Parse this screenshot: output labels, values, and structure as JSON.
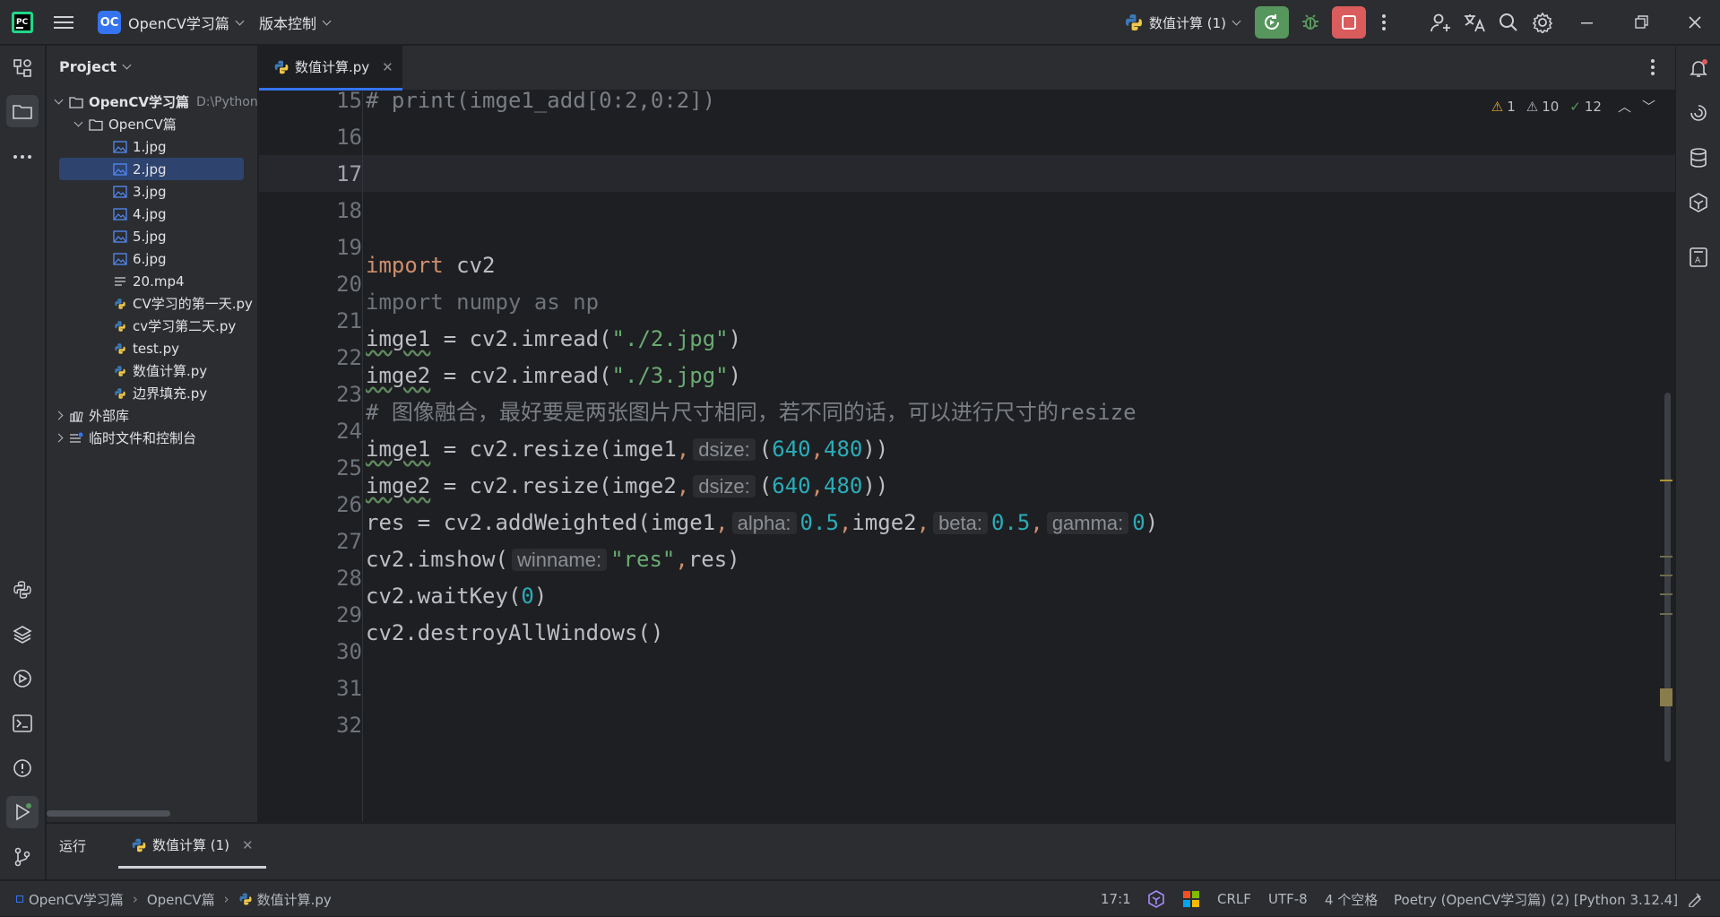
{
  "titlebar": {
    "project_badge": "OC",
    "project_name": "OpenCV学习篇",
    "vcs_label": "版本控制",
    "run_config": "数值计算 (1)"
  },
  "project_panel": {
    "title": "Project",
    "root": {
      "name": "OpenCV学习篇",
      "path": "D:\\Python"
    },
    "folder": "OpenCV篇",
    "files": [
      {
        "name": "1.jpg",
        "type": "image"
      },
      {
        "name": "2.jpg",
        "type": "image",
        "selected": true
      },
      {
        "name": "3.jpg",
        "type": "image"
      },
      {
        "name": "4.jpg",
        "type": "image"
      },
      {
        "name": "5.jpg",
        "type": "image"
      },
      {
        "name": "6.jpg",
        "type": "image"
      },
      {
        "name": "20.mp4",
        "type": "text"
      },
      {
        "name": "CV学习的第一天.py",
        "type": "python"
      },
      {
        "name": "cv学习第二天.py",
        "type": "python"
      },
      {
        "name": "test.py",
        "type": "python"
      },
      {
        "name": "数值计算.py",
        "type": "python"
      },
      {
        "name": "边界填充.py",
        "type": "python"
      }
    ],
    "external_libs": "外部库",
    "scratches": "临时文件和控制台"
  },
  "editor": {
    "tab_label": "数值计算.py",
    "inspections": {
      "warnings": "1",
      "weak_warnings": "10",
      "ok": "12"
    },
    "current_line": "17",
    "line_numbers": [
      "15",
      "16",
      "17",
      "18",
      "19",
      "20",
      "21",
      "22",
      "23",
      "24",
      "25",
      "26",
      "27",
      "28",
      "29",
      "30",
      "31",
      "32"
    ],
    "code": {
      "l15": "# print(imge1_add[0:2,0:2])",
      "l19_kw": "import",
      "l19_rest": " cv2",
      "l20": "import numpy as np",
      "l21_a": "imge1",
      "l21_b": " = cv2.imread(",
      "l21_str": "\"./2.jpg\"",
      "l21_c": ")",
      "l22_a": "imge2",
      "l22_b": " = cv2.imread(",
      "l22_str": "\"./3.jpg\"",
      "l22_c": ")",
      "l23": "# 图像融合，最好要是两张图片尺寸相同，若不同的话，可以进行尺寸的resize",
      "l24_a": "imge1",
      "l24_b": " = cv2.resize(imge1",
      "l24_hint": "dsize:",
      "l24_n1": "640",
      "l24_n2": "480",
      "l25_a": "imge2",
      "l25_b": " = cv2.resize(imge2",
      "l25_hint": "dsize:",
      "l25_n1": "640",
      "l25_n2": "480",
      "l26_a": "res = cv2.addWeighted(imge1",
      "l26_h1": "alpha:",
      "l26_n1": "0.5",
      "l26_b": "imge2",
      "l26_h2": "beta:",
      "l26_n2": "0.5",
      "l26_h3": "gamma:",
      "l26_n3": "0",
      "l27_a": "cv2.imshow(",
      "l27_hint": "winname:",
      "l27_str": "\"res\"",
      "l27_b": "res)",
      "l28_a": "cv2.waitKey(",
      "l28_n": "0",
      "l28_b": ")",
      "l29": "cv2.destroyAllWindows()"
    }
  },
  "bottom_panel": {
    "run_label": "运行",
    "run_tab": "数值计算 (1)"
  },
  "statusbar": {
    "breadcrumb": [
      "OpenCV学习篇",
      "OpenCV篇",
      "数值计算.py"
    ],
    "position": "17:1",
    "line_sep": "CRLF",
    "encoding": "UTF-8",
    "indent": "4 个空格",
    "interpreter": "Poetry (OpenCV学习篇) (2) [Python 3.12.4]"
  },
  "colors": {
    "accent": "#3574f0",
    "run_green": "#57965c",
    "stop_red": "#db5c5c",
    "keyword": "#cf8e6d",
    "string": "#6aab73",
    "number": "#2aacb8"
  }
}
